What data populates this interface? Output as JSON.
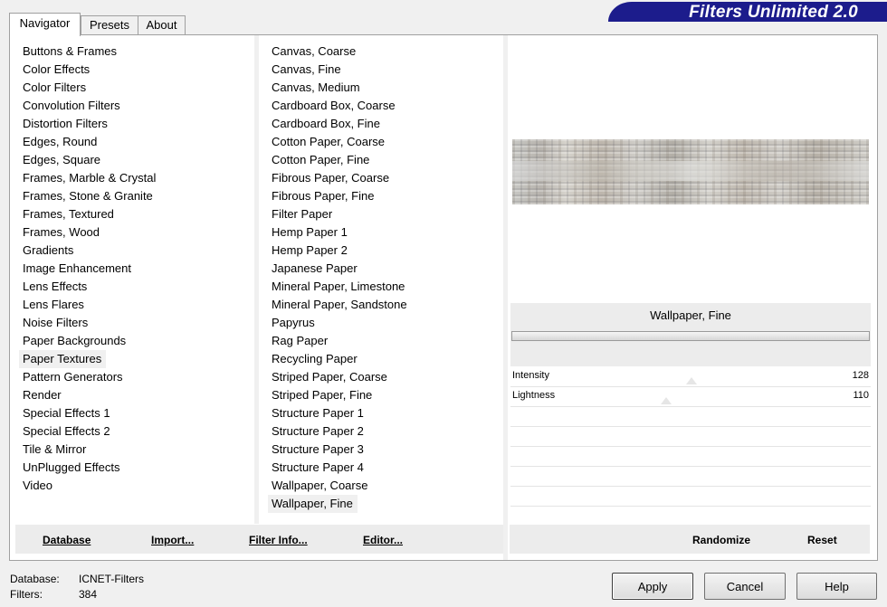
{
  "tabs": [
    {
      "label": "Navigator",
      "active": true
    },
    {
      "label": "Presets",
      "active": false
    },
    {
      "label": "About",
      "active": false
    }
  ],
  "logo_text": "Filters Unlimited 2.0",
  "categories": [
    "Buttons & Frames",
    "Color Effects",
    "Color Filters",
    "Convolution Filters",
    "Distortion Filters",
    "Edges, Round",
    "Edges, Square",
    "Frames, Marble & Crystal",
    "Frames, Stone & Granite",
    "Frames, Textured",
    "Frames, Wood",
    "Gradients",
    "Image Enhancement",
    "Lens Effects",
    "Lens Flares",
    "Noise Filters",
    "Paper Backgrounds",
    "Paper Textures",
    "Pattern Generators",
    "Render",
    "Special Effects 1",
    "Special Effects 2",
    "Tile & Mirror",
    "UnPlugged Effects",
    "Video"
  ],
  "selected_category": "Paper Textures",
  "filters": [
    "Canvas, Coarse",
    "Canvas, Fine",
    "Canvas, Medium",
    "Cardboard Box, Coarse",
    "Cardboard Box, Fine",
    "Cotton Paper, Coarse",
    "Cotton Paper, Fine",
    "Fibrous Paper, Coarse",
    "Fibrous Paper, Fine",
    "Filter Paper",
    "Hemp Paper 1",
    "Hemp Paper 2",
    "Japanese Paper",
    "Mineral Paper, Limestone",
    "Mineral Paper, Sandstone",
    "Papyrus",
    "Rag Paper",
    "Recycling Paper",
    "Striped Paper, Coarse",
    "Striped Paper, Fine",
    "Structure Paper 1",
    "Structure Paper 2",
    "Structure Paper 3",
    "Structure Paper 4",
    "Wallpaper, Coarse",
    "Wallpaper, Fine"
  ],
  "selected_filter": "Wallpaper, Fine",
  "current_filter_title": "Wallpaper, Fine",
  "params": [
    {
      "label": "Intensity",
      "value": "128",
      "fraction": 0.502
    },
    {
      "label": "Lightness",
      "value": "110",
      "fraction": 0.431
    }
  ],
  "left_buttons": {
    "database": "Database",
    "import": "Import...",
    "filter_info": "Filter Info...",
    "editor": "Editor..."
  },
  "right_buttons": {
    "randomize": "Randomize",
    "reset": "Reset"
  },
  "status": {
    "database_label": "Database:",
    "database_value": "ICNET-Filters",
    "filters_label": "Filters:",
    "filters_value": "384"
  },
  "dialog_buttons": {
    "apply": "Apply",
    "cancel": "Cancel",
    "help": "Help"
  },
  "colors": {
    "logo_bg": "#1c1c8c",
    "panel_bg": "#f0f0f0",
    "content_bg": "#ffffff"
  }
}
